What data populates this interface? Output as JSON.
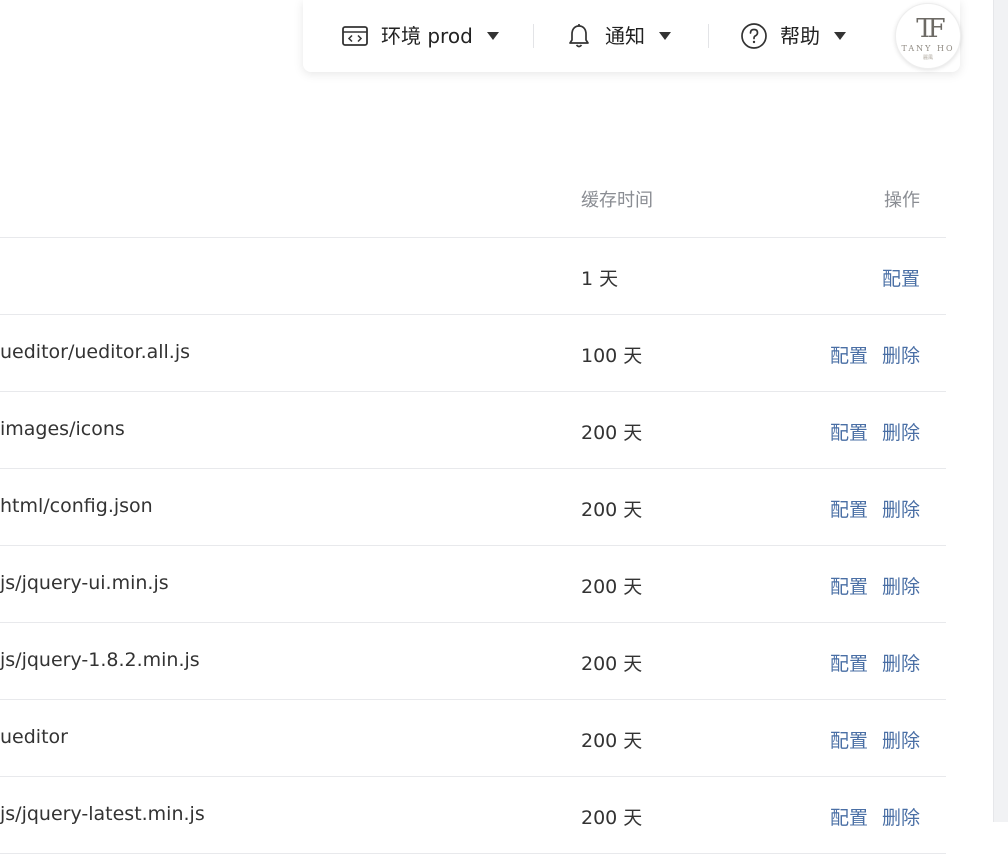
{
  "header": {
    "env_label": "环境 prod",
    "notify_label": "通知",
    "help_label": "帮助",
    "avatar": {
      "monogram": "TF",
      "brand": "TANY HO",
      "sub": "麗風"
    }
  },
  "table": {
    "columns": {
      "cache_time": "缓存时间",
      "actions": "操作"
    },
    "rows": [
      {
        "path": "",
        "cache": "1 天",
        "actions": [
          "配置"
        ]
      },
      {
        "path": "ueditor/ueditor.all.js",
        "cache": "100 天",
        "actions": [
          "配置",
          "删除"
        ]
      },
      {
        "path": "images/icons",
        "cache": "200 天",
        "actions": [
          "配置",
          "删除"
        ]
      },
      {
        "path": "html/config.json",
        "cache": "200 天",
        "actions": [
          "配置",
          "删除"
        ]
      },
      {
        "path": "js/jquery-ui.min.js",
        "cache": "200 天",
        "actions": [
          "配置",
          "删除"
        ]
      },
      {
        "path": "js/jquery-1.8.2.min.js",
        "cache": "200 天",
        "actions": [
          "配置",
          "删除"
        ]
      },
      {
        "path": "ueditor",
        "cache": "200 天",
        "actions": [
          "配置",
          "删除"
        ]
      },
      {
        "path": "js/jquery-latest.min.js",
        "cache": "200 天",
        "actions": [
          "配置",
          "删除"
        ]
      }
    ]
  },
  "colors": {
    "link": "#4a6fa5",
    "text": "#333333",
    "header_text": "#8a8d93",
    "divider": "#e8e9ec"
  },
  "icons": {
    "env": "code-window-icon",
    "notify": "bell-icon",
    "help": "help-circle-icon",
    "dropdown": "caret-down-icon"
  }
}
